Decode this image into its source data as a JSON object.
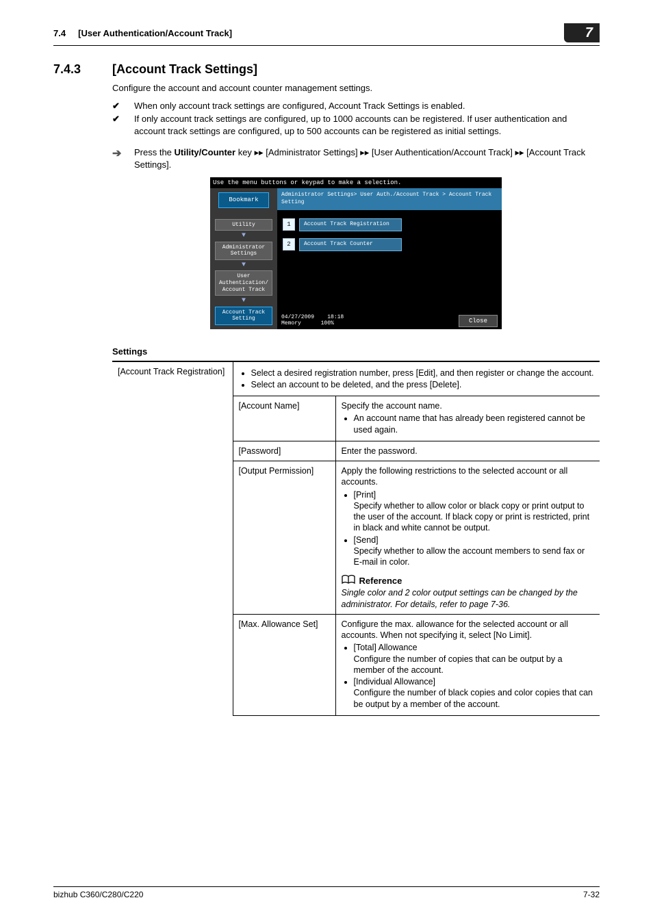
{
  "header": {
    "section_number": "7.4",
    "section_title": "[User Authentication/Account Track]",
    "chapter_number": "7"
  },
  "heading": {
    "number": "7.4.3",
    "title": "[Account Track Settings]"
  },
  "intro": "Configure the account and account counter management settings.",
  "checks": [
    "When only account track settings are configured, Account Track Settings is enabled.",
    "If only account track settings are configured, up to 1000 accounts can be registered. If user authentication and account track settings are configured, up to 500 accounts can be registered as initial settings."
  ],
  "procedure": {
    "pre": "Press the ",
    "key": "Utility/Counter",
    "mid1": " key ",
    "arrow": "▸▸",
    "seg1": " [Administrator Settings] ",
    "seg2": " [User Authentication/Account Track] ",
    "seg3": " [Account Track Settings]."
  },
  "screenshot": {
    "topbar": "Use the menu buttons or keypad to make a selection.",
    "bookmark": "Bookmark",
    "nav": {
      "utility": "Utility",
      "admin": "Administrator\nSettings",
      "userauth": "User\nAuthentication/\nAccount Track",
      "acct": "Account Track\nSetting"
    },
    "breadcrumb": "Administrator Settings> User Auth./Account Track > Account Track Setting",
    "options": [
      {
        "num": "1",
        "label": "Account Track Registration"
      },
      {
        "num": "2",
        "label": "Account Track Counter"
      }
    ],
    "footer_date": "04/27/2009",
    "footer_time": "18:18",
    "footer_mem_label": "Memory",
    "footer_mem_val": "100%",
    "close": "Close"
  },
  "settings_title": "Settings",
  "table": {
    "row1_col1": "[Account Track Registration]",
    "row1_bullets": [
      "Select a desired registration number, press [Edit], and then register or change the account.",
      "Select an account to be deleted, and the press [Delete]."
    ],
    "sub": [
      {
        "name": "[Account Name]",
        "desc_lead": "Specify the account name.",
        "bullets": [
          "An account name that has already been registered cannot be used again."
        ]
      },
      {
        "name": "[Password]",
        "desc_lead": "Enter the password."
      },
      {
        "name": "[Output Permission]",
        "desc_lead": "Apply the following restrictions to the selected account or all accounts.",
        "bullets": [
          "[Print]\nSpecify whether to allow color or black copy or print output to the user of the account. If black copy or print is restricted, print in black and white cannot be output.",
          "[Send]\nSpecify whether to allow the account members to send fax or E-mail in color."
        ],
        "reference_title": "Reference",
        "reference_body": "Single color and 2 color output settings can be changed by the administrator. For details, refer to page 7-36."
      },
      {
        "name": "[Max. Allowance Set]",
        "desc_lead": "Configure the max. allowance for the selected account or all accounts. When not specifying it, select [No Limit].",
        "bullets": [
          "[Total] Allowance\nConfigure the number of copies that can be output by a member of the account.",
          "[Individual Allowance]\nConfigure the number of black copies and color copies that can be output by a member of the account."
        ]
      }
    ]
  },
  "footer": {
    "product": "bizhub C360/C280/C220",
    "page": "7-32"
  }
}
